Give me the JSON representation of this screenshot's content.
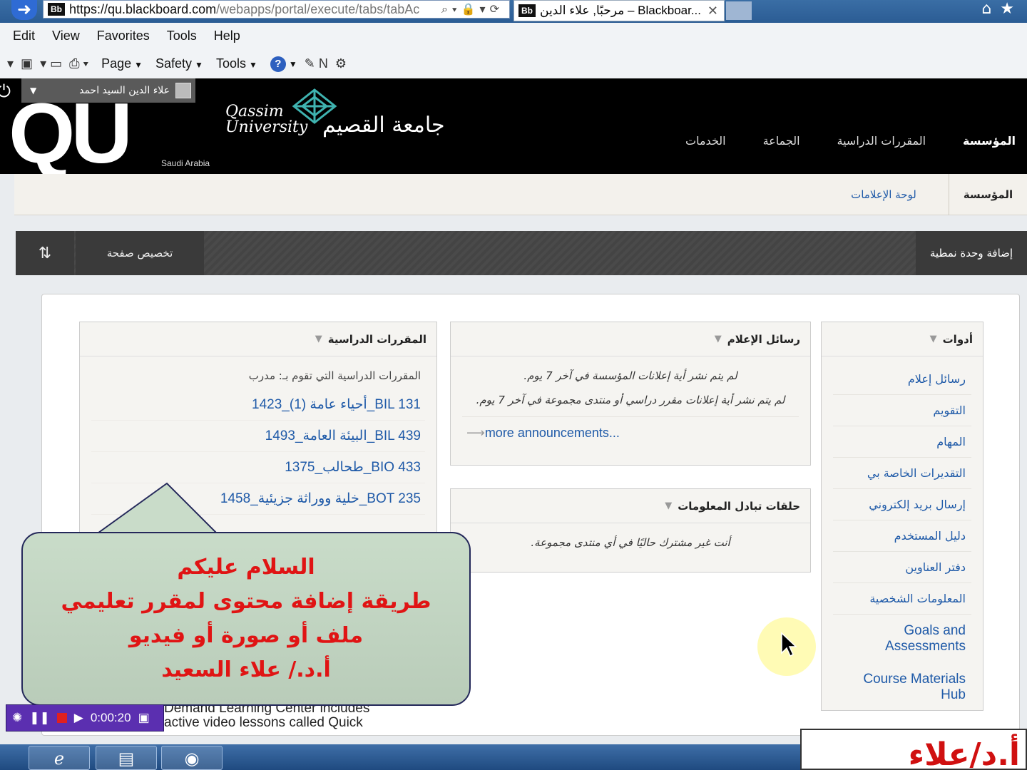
{
  "browser": {
    "url_host": "https://qu.blackboard.com",
    "url_path": "/webapps/portal/execute/tabs/tabAc",
    "favicon_text": "Bb",
    "tab_title": "مرحبًا, علاء الدين – Blackboar...",
    "menu": [
      "Edit",
      "View",
      "Favorites",
      "Tools",
      "Help"
    ],
    "cmd_items": [
      "Page",
      "Safety",
      "Tools"
    ]
  },
  "bb": {
    "user_name": "علاء الدين السيد احمد",
    "logo_text": "QU",
    "logo_sub": "Saudi Arabia",
    "uni_en_line1": "Qassim",
    "uni_en_line2": "University",
    "uni_ar": "جامعة القصيم",
    "top_nav": [
      "المؤسسة",
      "المقررات الدراسية",
      "الجماعة",
      "الخدمات"
    ],
    "sub_tabs": [
      "المؤسسة",
      "لوحة الإعلامات"
    ],
    "add_module": "إضافة وحدة نمطية",
    "customize": "تخصيص صفحة"
  },
  "tools": {
    "title": "أدوات",
    "items": [
      "رسائل إعلام",
      "التقويم",
      "المهام",
      "التقديرات الخاصة بي",
      "إرسال بريد إلكتروني",
      "دليل المستخدم",
      "دفتر العناوين",
      "المعلومات الشخصية"
    ],
    "items_en": [
      "Goals and Assessments",
      "Course Materials Hub"
    ]
  },
  "announcements": {
    "title": "رسائل الإعلام",
    "line1": "لم يتم نشر أية إعلانات المؤسسة في آخر 7 يوم.",
    "line2": "لم يتم نشر أية إعلانات مقرر دراسي أو منتدى مجموعة في آخر 7 يوم.",
    "more": "more announcements..."
  },
  "groups": {
    "title": "حلقات تبادل المعلومات",
    "text": "أنت غير مشترك حاليًا في أي منتدى مجموعة."
  },
  "courses": {
    "title": "المقررات الدراسية",
    "subtitle": "المقررات الدراسية التي تقوم بـ: مدرب",
    "items": [
      "BIL 131_أحياء عامة (1)_1423",
      "BIL 439_البيئة العامة_1493",
      "BIO 433_طحالب_1375",
      "BOT 235_خلية ووراثة جزيئية_1458"
    ]
  },
  "overlay": {
    "lines": [
      "السلام عليكم",
      "طريقة إضافة محتوى لمقرر تعليمي",
      "ملف أو صورة أو فيديو",
      "أ.د./ علاء السعيد"
    ],
    "below_line1": "Demand Learning Center includes",
    "below_line2": "active video lessons called Quick"
  },
  "recorder": {
    "time": "0:00:20"
  },
  "watermark": "أ.د/علاء السعيد",
  "colors": {
    "link": "#1f5aa8",
    "overlay_text": "#e01414",
    "header_bg": "#000000"
  }
}
